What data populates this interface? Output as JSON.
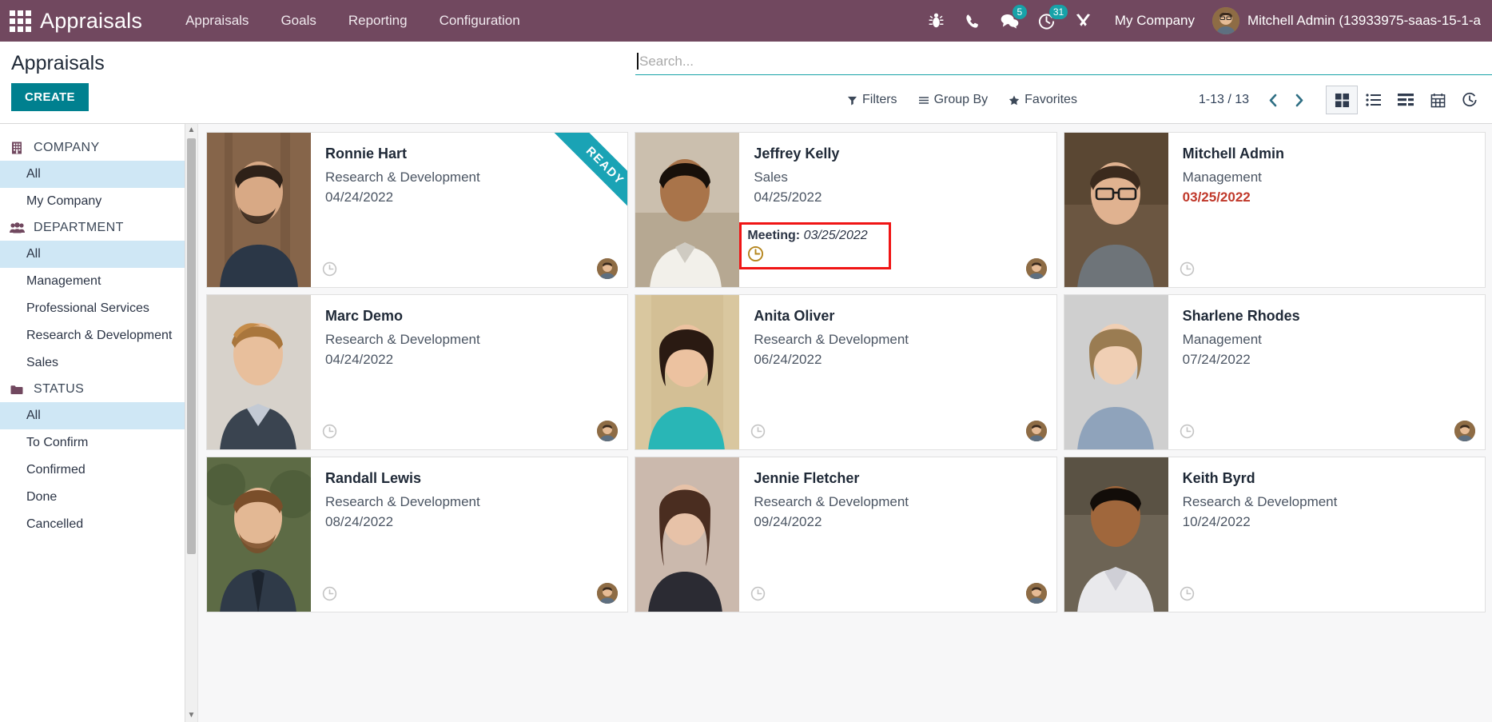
{
  "navbar": {
    "apps_icon": "apps-grid-icon",
    "brand": "Appraisals",
    "menu": [
      {
        "label": "Appraisals"
      },
      {
        "label": "Goals"
      },
      {
        "label": "Reporting"
      },
      {
        "label": "Configuration"
      }
    ],
    "icons": [
      {
        "name": "bug-icon",
        "badge": null
      },
      {
        "name": "phone-icon",
        "badge": null
      },
      {
        "name": "messages-icon",
        "badge": "5"
      },
      {
        "name": "activities-clock-icon",
        "badge": "31"
      },
      {
        "name": "tools-icon",
        "badge": null
      }
    ],
    "company": "My Company",
    "user": "Mitchell Admin (13933975-saas-15-1-a",
    "bg_color": "#71485f",
    "badge_color": "#17a2a8"
  },
  "control_panel": {
    "title": "Appraisals",
    "create_label": "CREATE",
    "create_color": "#00808f",
    "search": {
      "value": "",
      "placeholder": "Search..."
    },
    "facets": [
      {
        "label": "Filters",
        "icon": "filter-icon"
      },
      {
        "label": "Group By",
        "icon": "bars-icon"
      },
      {
        "label": "Favorites",
        "icon": "star-icon"
      }
    ],
    "pager": {
      "count": "1-13 / 13",
      "prev_icon": "chevron-left-icon",
      "next_icon": "chevron-right-icon"
    },
    "views": [
      {
        "name": "kanban-view",
        "icon": "kanban-icon",
        "active": true
      },
      {
        "name": "list-view",
        "icon": "list-icon",
        "active": false
      },
      {
        "name": "pivot-view",
        "icon": "pivot-icon",
        "active": false
      },
      {
        "name": "calendar-view",
        "icon": "calendar-icon",
        "active": false
      },
      {
        "name": "activity-view",
        "icon": "clock-icon",
        "active": false
      }
    ]
  },
  "sidebar": {
    "sections": [
      {
        "title": "COMPANY",
        "icon": "building-icon",
        "items": [
          {
            "label": "All",
            "selected": true
          },
          {
            "label": "My Company",
            "selected": false
          }
        ]
      },
      {
        "title": "DEPARTMENT",
        "icon": "people-icon",
        "items": [
          {
            "label": "All",
            "selected": true
          },
          {
            "label": "Management",
            "selected": false
          },
          {
            "label": "Professional Services",
            "selected": false
          },
          {
            "label": "Research & Development",
            "selected": false
          },
          {
            "label": "Sales",
            "selected": false
          }
        ]
      },
      {
        "title": "STATUS",
        "icon": "folder-icon",
        "items": [
          {
            "label": "All",
            "selected": true
          },
          {
            "label": "To Confirm",
            "selected": false
          },
          {
            "label": "Confirmed",
            "selected": false
          },
          {
            "label": "Done",
            "selected": false
          },
          {
            "label": "Cancelled",
            "selected": false
          }
        ]
      }
    ]
  },
  "kanban": {
    "cards": [
      {
        "name": "Ronnie Hart",
        "department": "Research & Development",
        "date": "04/24/2022",
        "overdue": false,
        "ribbon": "READY",
        "ribbon_color": "#1aa3b5",
        "meeting": null,
        "photo_colors": [
          "#8c6a4f",
          "#5b4634"
        ],
        "skin": "#d8a985",
        "hair": "#2e2118",
        "shirt": "#2b3747"
      },
      {
        "name": "Jeffrey Kelly",
        "department": "Sales",
        "date": "04/25/2022",
        "overdue": false,
        "ribbon": null,
        "meeting": {
          "label": "Meeting:",
          "date": "03/25/2022",
          "border_color": "#f01515",
          "clock_color": "#b5861e"
        },
        "photo_colors": [
          "#cbbfae",
          "#a89a86"
        ],
        "skin": "#a9744a",
        "hair": "#1a1209",
        "shirt": "#f2f0ea"
      },
      {
        "name": "Mitchell Admin",
        "department": "Management",
        "date": "03/25/2022",
        "overdue": true,
        "ribbon": null,
        "meeting": null,
        "photo_colors": [
          "#6b5641",
          "#4a3a2a"
        ],
        "skin": "#e0b290",
        "hair": "#3b2a1d",
        "shirt": "#6e7479"
      },
      {
        "name": "Marc Demo",
        "department": "Research & Development",
        "date": "04/24/2022",
        "overdue": false,
        "ribbon": null,
        "meeting": null,
        "photo_colors": [
          "#d7d2cb",
          "#b4ada3"
        ],
        "skin": "#e8bf9c",
        "hair": "#a9763c",
        "shirt": "#3a4450"
      },
      {
        "name": "Anita Oliver",
        "department": "Research & Development",
        "date": "06/24/2022",
        "overdue": false,
        "ribbon": null,
        "meeting": null,
        "photo_colors": [
          "#d9c79f",
          "#b9a478"
        ],
        "skin": "#ecc2a0",
        "hair": "#2a1a12",
        "shirt": "#29b6b6"
      },
      {
        "name": "Sharlene Rhodes",
        "department": "Management",
        "date": "07/24/2022",
        "overdue": false,
        "ribbon": null,
        "meeting": null,
        "photo_colors": [
          "#cfcfcf",
          "#a8a8a8"
        ],
        "skin": "#f0cfb4",
        "hair": "#9a7c52",
        "shirt": "#8fa3bb"
      },
      {
        "name": "Randall Lewis",
        "department": "Research & Development",
        "date": "08/24/2022",
        "overdue": false,
        "ribbon": null,
        "meeting": null,
        "photo_colors": [
          "#5d6b45",
          "#3e4a2e"
        ],
        "skin": "#e3b894",
        "hair": "#7a4e2a",
        "shirt": "#2f3a48"
      },
      {
        "name": "Jennie Fletcher",
        "department": "Research & Development",
        "date": "09/24/2022",
        "overdue": false,
        "ribbon": null,
        "meeting": null,
        "photo_colors": [
          "#cbb9ad",
          "#9c8579"
        ],
        "skin": "#e7c2a8",
        "hair": "#4a2d20",
        "shirt": "#2b2b33"
      },
      {
        "name": "Keith Byrd",
        "department": "Research & Development",
        "date": "10/24/2022",
        "overdue": false,
        "ribbon": null,
        "meeting": null,
        "photo_colors": [
          "#6d6455",
          "#4c4438"
        ],
        "skin": "#a0673c",
        "hair": "#120d09",
        "shirt": "#e9e9ec"
      }
    ]
  }
}
